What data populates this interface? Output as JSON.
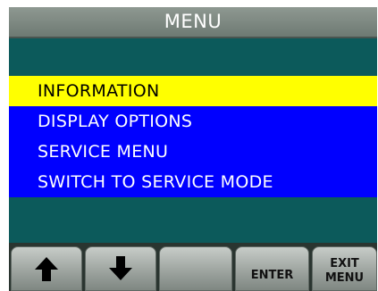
{
  "title": "MENU",
  "menu": {
    "items": [
      {
        "label": "INFORMATION",
        "selected": true
      },
      {
        "label": "DISPLAY OPTIONS",
        "selected": false
      },
      {
        "label": "SERVICE MENU",
        "selected": false
      },
      {
        "label": "SWITCH TO SERVICE MODE",
        "selected": false
      }
    ]
  },
  "softkeys": {
    "up_icon": "arrow-up-icon",
    "down_icon": "arrow-down-icon",
    "enter_label": "ENTER",
    "exit_line1": "EXIT",
    "exit_line2": "MENU"
  },
  "colors": {
    "screen_bg": "#0c5a5b",
    "item_bg": "#0000ff",
    "selected_bg": "#ffff00",
    "title_bg": "#7f8a83"
  }
}
